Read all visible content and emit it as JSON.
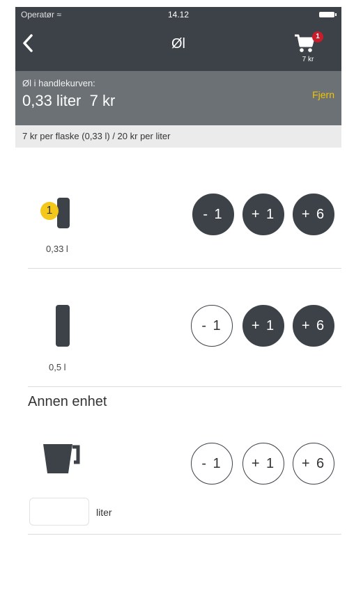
{
  "status": {
    "operator": "Operatør",
    "time": "14.12"
  },
  "nav": {
    "title": "Øl",
    "cart_count": "1",
    "cart_amount": "7 kr"
  },
  "basket": {
    "label": "Øl i handlekurven:",
    "value": "0,33 liter  7 kr",
    "remove_label": "Fjern"
  },
  "price_info": "7 kr per flaske (0,33 l) / 20 kr per liter",
  "items": [
    {
      "size": "0,33 l",
      "quantity": "1",
      "buttons": [
        {
          "label": "- 1",
          "style": "dark"
        },
        {
          "label": "+ 1",
          "style": "dark"
        },
        {
          "label": "+ 6",
          "style": "dark"
        }
      ]
    },
    {
      "size": "0,5 l",
      "buttons": [
        {
          "label": "- 1",
          "style": "light"
        },
        {
          "label": "+ 1",
          "style": "dark"
        },
        {
          "label": "+ 6",
          "style": "dark"
        }
      ]
    }
  ],
  "other_unit": {
    "heading": "Annen enhet",
    "buttons": [
      {
        "label": "- 1",
        "style": "light"
      },
      {
        "label": "+ 1",
        "style": "light"
      },
      {
        "label": "+ 6",
        "style": "light"
      }
    ],
    "input_value": "",
    "input_unit": "liter"
  },
  "colors": {
    "dark": "#3c4248",
    "accent": "#f4c81a",
    "badge": "#c81e2b",
    "remove": "#f2c500"
  },
  "icons": {
    "back": "chevron-left-icon",
    "cart": "shopping-cart-icon",
    "bottle": "bottle-icon",
    "pitcher": "measuring-jug-icon"
  }
}
